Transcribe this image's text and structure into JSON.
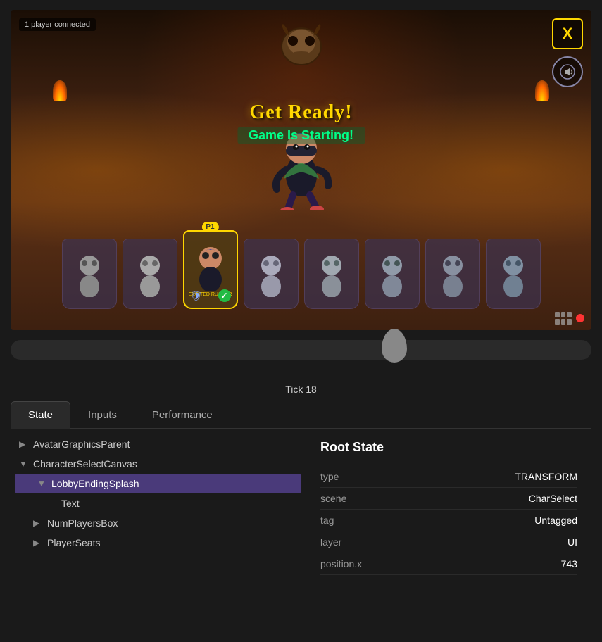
{
  "game": {
    "player_connected": "1 player connected",
    "get_ready": "Get Ready!",
    "game_starting": "Game Is Starting!",
    "tick_label": "Tick 18",
    "tick_value": 18,
    "corner_x_label": "X",
    "p1_badge": "P1",
    "character_name": "EXCITED RUSHER",
    "red_dot_label": "recording",
    "corner_audio_symbol": "🔊"
  },
  "tabs": [
    {
      "id": "state",
      "label": "State",
      "active": true
    },
    {
      "id": "inputs",
      "label": "Inputs",
      "active": false
    },
    {
      "id": "performance",
      "label": "Performance",
      "active": false
    }
  ],
  "tree": {
    "items": [
      {
        "id": "avatar-graphics-parent",
        "label": "AvatarGraphicsParent",
        "level": 0,
        "expanded": false,
        "selected": false,
        "arrow": "▶"
      },
      {
        "id": "character-select-canvas",
        "label": "CharacterSelectCanvas",
        "level": 0,
        "expanded": true,
        "selected": false,
        "arrow": "▼"
      },
      {
        "id": "lobby-ending-splash",
        "label": "LobbyEndingSplash",
        "level": 1,
        "expanded": true,
        "selected": true,
        "arrow": "▼"
      },
      {
        "id": "text",
        "label": "Text",
        "level": 2,
        "expanded": false,
        "selected": false,
        "arrow": ""
      },
      {
        "id": "num-players-box",
        "label": "NumPlayersBox",
        "level": 1,
        "expanded": false,
        "selected": false,
        "arrow": "▶"
      },
      {
        "id": "player-seats",
        "label": "PlayerSeats",
        "level": 1,
        "expanded": false,
        "selected": false,
        "arrow": "▶"
      }
    ]
  },
  "state_panel": {
    "title": "Root State",
    "rows": [
      {
        "key": "type",
        "value": "TRANSFORM"
      },
      {
        "key": "scene",
        "value": "CharSelect"
      },
      {
        "key": "tag",
        "value": "Untagged"
      },
      {
        "key": "layer",
        "value": "UI"
      },
      {
        "key": "position.x",
        "value": "743"
      }
    ]
  },
  "characters": [
    {
      "id": "c1",
      "selected": false,
      "color": "#888"
    },
    {
      "id": "c2",
      "selected": false,
      "color": "#888"
    },
    {
      "id": "c3",
      "selected": true,
      "color": "#8866cc"
    },
    {
      "id": "c4",
      "selected": false,
      "color": "#888"
    },
    {
      "id": "c5",
      "selected": false,
      "color": "#888"
    },
    {
      "id": "c6",
      "selected": false,
      "color": "#888"
    },
    {
      "id": "c7",
      "selected": false,
      "color": "#888"
    },
    {
      "id": "c8",
      "selected": false,
      "color": "#888"
    }
  ]
}
